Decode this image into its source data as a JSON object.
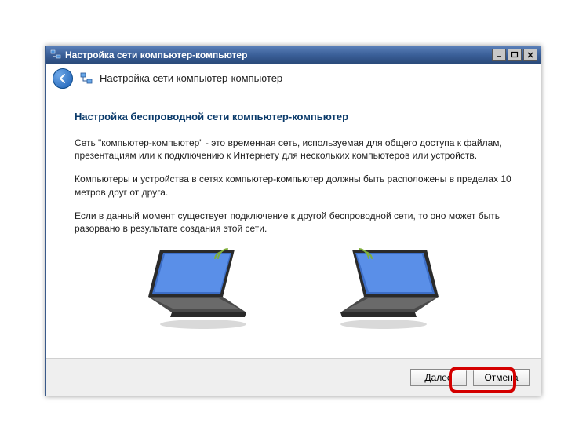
{
  "titlebar": {
    "title": "Настройка сети компьютер-компьютер"
  },
  "header": {
    "title": "Настройка сети компьютер-компьютер"
  },
  "content": {
    "heading": "Настройка беспроводной сети компьютер-компьютер",
    "p1": "Сеть \"компьютер-компьютер\" - это временная сеть, используемая для общего доступа к файлам, презентациям или к подключению к Интернету для нескольких компьютеров или устройств.",
    "p2": "Компьютеры и устройства в сетях компьютер-компьютер должны быть расположены в пределах 10 метров друг от друга.",
    "p3": "Если в данный момент существует подключение к другой беспроводной сети, то оно может быть разорвано в результате создания этой сети."
  },
  "footer": {
    "next": "Далее",
    "cancel": "Отмена"
  }
}
